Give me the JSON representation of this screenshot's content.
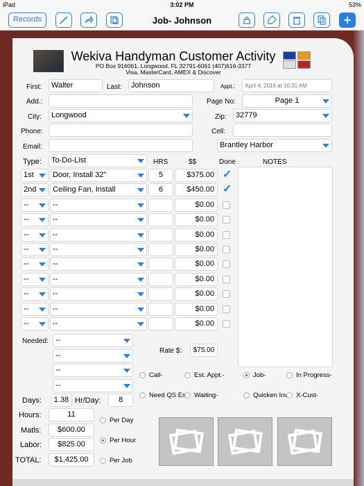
{
  "status": {
    "carrier": "iPad",
    "time": "3:02 PM",
    "battery": "53%"
  },
  "nav": {
    "records_label": "Records",
    "title": "Job- Johnson"
  },
  "header": {
    "company": "Wekiva Handyman Customer Activity",
    "address": "PO Box 916061, Longwood, FL 32791-6061 (407)616-3377",
    "payments": "Visa, MasterCard, AMEX & Discover"
  },
  "labels": {
    "first": "First:",
    "last": "Last:",
    "appt": "Appt.:",
    "add": "Add.:",
    "page_no": "Page No:",
    "city": "City:",
    "zip": "Zip:",
    "phone": "Phone:",
    "cell": "Cell:",
    "email": "Email:",
    "type": "Type:",
    "hrs": "HRS",
    "money": "$$",
    "done": "Done",
    "notes": "NOTES",
    "needed": "Needed:",
    "rate": "Rate $:",
    "days": "Days:",
    "hr_day": "Hr/Day:",
    "hours": "Hours:",
    "matls": "Matls:",
    "labor": "Labor:",
    "total": "TOTAL:"
  },
  "customer": {
    "first": "Walter",
    "last": "Johnson",
    "appt": "April 4, 2016 at 10:31 AM",
    "address": "",
    "page_no": "Page 1",
    "city": "Longwood",
    "zip": "32779",
    "phone": "",
    "cell": "",
    "email": "",
    "area": "Brantley Harbor"
  },
  "job_type": "To-Do-List",
  "rows": [
    {
      "pri": "1st",
      "task": "Door, Install 32\"",
      "hrs": "5",
      "amount": "$375.00",
      "done": true
    },
    {
      "pri": "2nd",
      "task": "Ceiling Fan, Install",
      "hrs": "6",
      "amount": "$450.00",
      "done": true
    },
    {
      "pri": "--",
      "task": "--",
      "hrs": "",
      "amount": "$0.00",
      "done": false
    },
    {
      "pri": "--",
      "task": "--",
      "hrs": "",
      "amount": "$0.00",
      "done": false
    },
    {
      "pri": "--",
      "task": "--",
      "hrs": "",
      "amount": "$0.00",
      "done": false
    },
    {
      "pri": "--",
      "task": "--",
      "hrs": "",
      "amount": "$0.00",
      "done": false
    },
    {
      "pri": "--",
      "task": "--",
      "hrs": "",
      "amount": "$0.00",
      "done": false
    },
    {
      "pri": "--",
      "task": "--",
      "hrs": "",
      "amount": "$0.00",
      "done": false
    },
    {
      "pri": "--",
      "task": "--",
      "hrs": "",
      "amount": "$0.00",
      "done": false
    },
    {
      "pri": "--",
      "task": "--",
      "hrs": "",
      "amount": "$0.00",
      "done": false
    },
    {
      "pri": "--",
      "task": "--",
      "hrs": "",
      "amount": "$0.00",
      "done": false
    }
  ],
  "needed": [
    "--",
    "--",
    "--",
    "--"
  ],
  "rate": "$75.00",
  "status_options": [
    {
      "label": "Call-",
      "on": false
    },
    {
      "label": "Est. Appt.-",
      "on": false
    },
    {
      "label": "Job-",
      "on": true
    },
    {
      "label": "In Progress-",
      "on": false
    },
    {
      "label": "Need QS Est",
      "on": false
    },
    {
      "label": "Waiting-",
      "on": false
    },
    {
      "label": "Quicken Inv",
      "on": false
    },
    {
      "label": "X-Cust-",
      "on": false
    }
  ],
  "totals": {
    "days": "1.38",
    "hr_day": "8",
    "hours": "11",
    "matls": "$600.00",
    "labor": "$825.00",
    "total": "$1,425.00"
  },
  "rate_mode": [
    {
      "label": "Per Day",
      "on": false
    },
    {
      "label": "Per Hour",
      "on": true
    },
    {
      "label": "Per Job",
      "on": false
    }
  ],
  "colors": {
    "accent": "#2a7fe0",
    "background": "#6e2a22"
  }
}
